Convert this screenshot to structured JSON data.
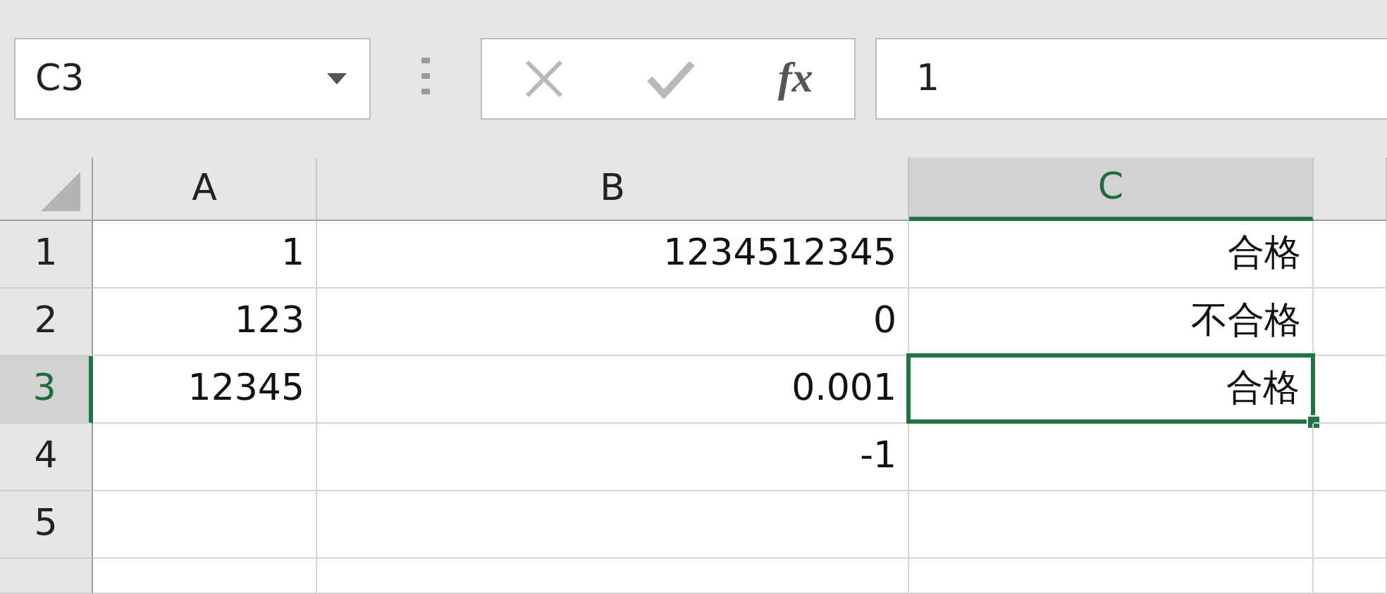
{
  "name_box": {
    "value": "C3"
  },
  "formula_buttons": [
    {
      "kind": "cancel",
      "disabled": true
    },
    {
      "kind": "enter",
      "disabled": true
    },
    {
      "kind": "function",
      "disabled": false,
      "label": "fx"
    }
  ],
  "formula": {
    "value": "1"
  },
  "columns": [
    {
      "label": "A",
      "selected": false
    },
    {
      "label": "B",
      "selected": false
    },
    {
      "label": "C",
      "selected": true
    }
  ],
  "rows": [
    {
      "label": "1",
      "selected": false,
      "cells": [
        {
          "text": "1",
          "selected": false
        },
        {
          "text": "1234512345",
          "selected": false
        },
        {
          "text": "合格",
          "selected": false
        }
      ]
    },
    {
      "label": "2",
      "selected": false,
      "cells": [
        {
          "text": "123",
          "selected": false
        },
        {
          "text": "0",
          "selected": false
        },
        {
          "text": "不合格",
          "selected": false
        }
      ]
    },
    {
      "label": "3",
      "selected": true,
      "cells": [
        {
          "text": "12345",
          "selected": false
        },
        {
          "text": "0.001",
          "selected": false
        },
        {
          "text": "合格",
          "selected": true
        }
      ]
    },
    {
      "label": "4",
      "selected": false,
      "cells": [
        {
          "selected": false
        },
        {
          "text": "-1",
          "selected": false
        },
        {
          "selected": false
        }
      ]
    },
    {
      "label": "5",
      "selected": false,
      "cells": [
        {
          "selected": false
        },
        {
          "selected": false
        },
        {
          "selected": false
        }
      ]
    }
  ]
}
